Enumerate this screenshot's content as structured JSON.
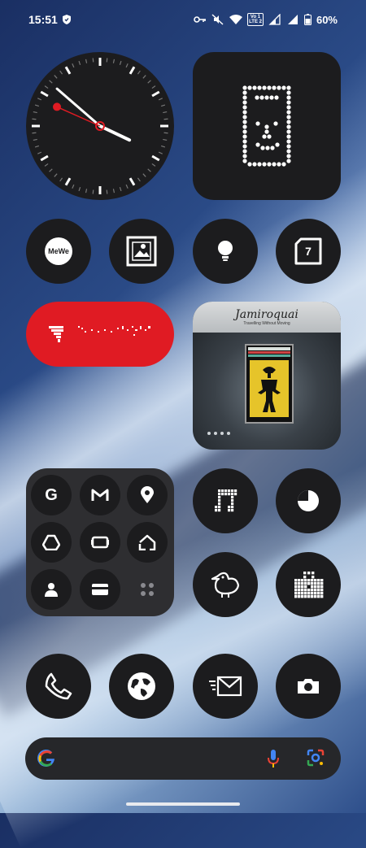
{
  "status_bar": {
    "time": "15:51",
    "battery": "60%",
    "lte_top": "Vo",
    "lte_mid": "LTE",
    "lte_num": "1",
    "lte_num2": "2"
  },
  "clock": {
    "hour": 15,
    "minute": 51,
    "second": 49
  },
  "widgets": {
    "glyph_calendar_day": "7",
    "mewe_label": "MeWe",
    "album": {
      "title": "Jamiroquai",
      "subtitle": "Travelling Without Moving"
    }
  },
  "folder_apps": [
    "google-app",
    "gmail-app",
    "maps-app",
    "drive-app",
    "tv-app",
    "home-app",
    "contacts-app",
    "wallet-app",
    "apps-grid"
  ],
  "colors": {
    "tile": "#1c1c1e",
    "red_pill": "#e01b23",
    "folder": "#2e2e31"
  }
}
